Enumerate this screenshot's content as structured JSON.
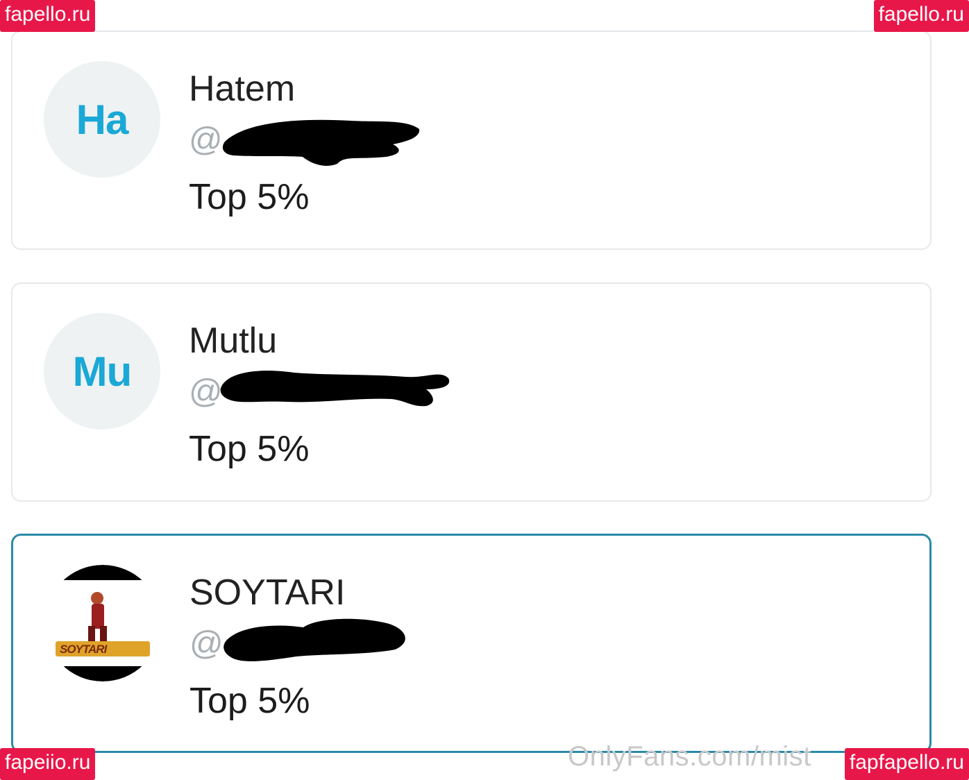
{
  "cards": [
    {
      "avatar_initials": "Ha",
      "name": "Hatem",
      "handle": "@",
      "rank": "Top 5%"
    },
    {
      "avatar_initials": "Mu",
      "name": "Mutlu",
      "handle": "@",
      "rank": "Top 5%"
    },
    {
      "avatar_initials": "",
      "avatar_logo_text": "SOYTARI",
      "name": "SOYTARI",
      "handle": "@",
      "rank": "Top 5%",
      "selected": true
    }
  ],
  "watermarks": {
    "top_left": "fapello.ru",
    "top_right": "fapello.ru",
    "bottom_left": "fapeiio.ru",
    "bottom_right": "fapfapello.ru",
    "onlyfans": "OnlyFans.com/mist"
  },
  "colors": {
    "initials": "#1aa8d6",
    "selected_border": "#2a8aa8",
    "watermark_bg": "#e8174a"
  }
}
